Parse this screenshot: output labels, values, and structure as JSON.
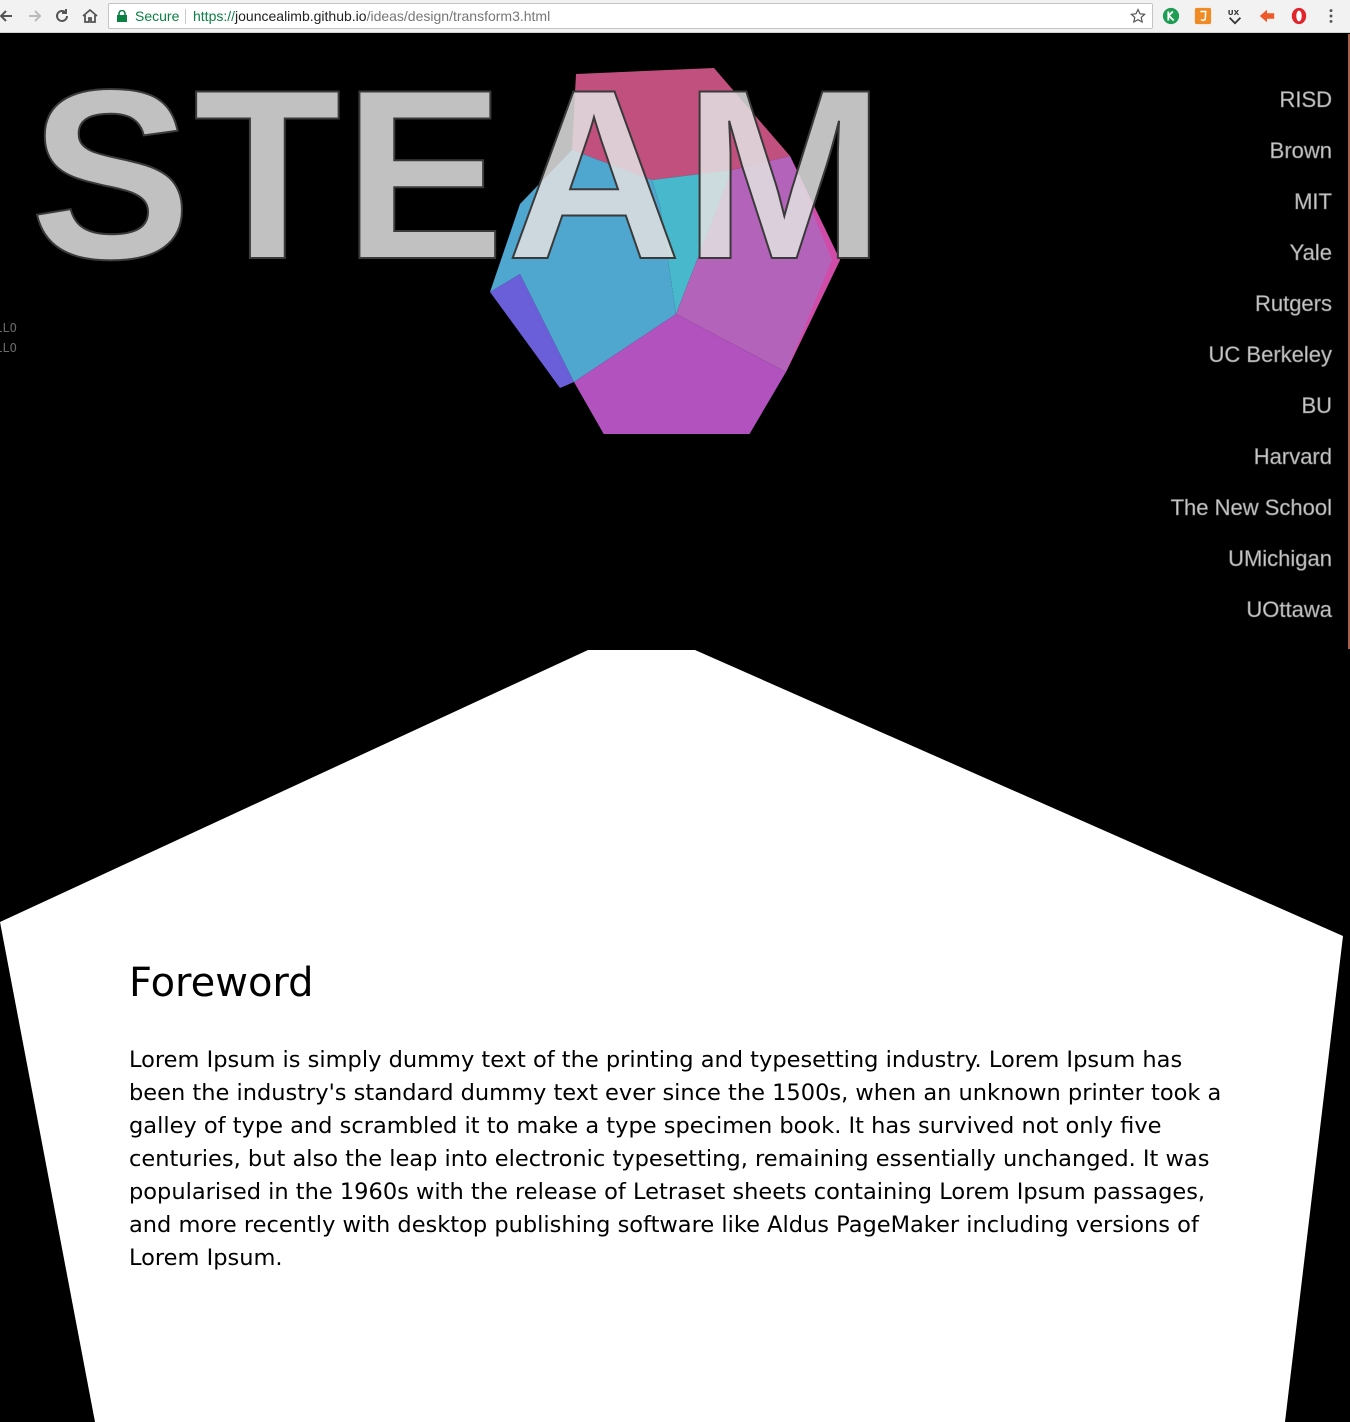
{
  "browser": {
    "security_label": "Secure",
    "url_scheme": "https://",
    "url_host": "jouncealimb.github.io",
    "url_path": "/ideas/design/transform3.html",
    "extensions": [
      "k-extension-icon",
      "html5-extension-icon",
      "ux-extension-icon",
      "arrow-extension-icon",
      "opera-extension-icon"
    ]
  },
  "hero": {
    "title": "STEAM",
    "debug_lines": [
      "ELLO",
      "ELLO"
    ]
  },
  "nav": {
    "items": [
      "RISD",
      "Brown",
      "MIT",
      "Yale",
      "Rutgers",
      "UC Berkeley",
      "BU",
      "Harvard",
      "The New School",
      "UMichigan",
      "UOttawa"
    ]
  },
  "foreword": {
    "title": "Foreword",
    "body": "Lorem Ipsum is simply dummy text of the printing and typesetting industry. Lorem Ipsum has been the industry's standard dummy text ever since the 1500s, when an unknown printer took a galley of type and scrambled it to make a type specimen book. It has survived not only five centuries, but also the leap into electronic typesetting, remaining essentially unchanged. It was popularised in the 1960s with the release of Letraset sheets containing Lorem Ipsum passages, and more recently with desktop publishing software like Aldus PageMaker including versions of Lorem Ipsum."
  },
  "colors": {
    "page_background": "#000000",
    "panel_background": "#ffffff",
    "nav_text": "#c9c9c9",
    "dodeca_faces": [
      "#c2507e",
      "#4fa6cf",
      "#b463ba",
      "#b152bf",
      "#6a5fd8",
      "#d04ca8",
      "#48b8cc"
    ]
  }
}
